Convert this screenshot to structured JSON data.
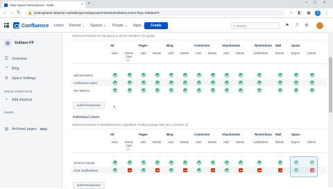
{
  "browser": {
    "tab_title": "View Space Permissions - Soliti...",
    "url": "jessicajosele.atlassian.net/wiki/spaces/spacepermissions/editview.action?key=SolitareFF"
  },
  "header": {
    "brand": "Confluence",
    "nav": [
      "Home",
      "Recent ⌄",
      "Spaces ⌄",
      "People ⌄",
      "Apps ⌄"
    ],
    "create_label": "Create",
    "search_placeholder": "Search"
  },
  "sidebar": {
    "space_name": "Solitare FF",
    "items": [
      "Overview",
      "Blog",
      "Space Settings"
    ],
    "shortcuts_heading": "SPACE SHORTCUTS",
    "add_shortcut": "Add shortcut",
    "pages_heading": "PAGES",
    "archived_pages": "Archived pages",
    "beta": "BETA"
  },
  "groups_section": {
    "description": "Grant permissions for this space to all the members of a group.",
    "row_labels": [
      "administrators",
      "confluence-users",
      "site-admins"
    ],
    "edit_button": "Edit Permissions"
  },
  "individual_section": {
    "title": "Individual Users",
    "description": "Grant permissions to individual users, regardless of which groups they are a member of.",
    "row_labels": [
      "Jessica Ciprate",
      "Chat Notifications"
    ],
    "edit_button": "Edit Permissions"
  },
  "table_groups": [
    "All",
    "Pages",
    "Blog",
    "Comments",
    "Attachments",
    "Restrictions",
    "Mail",
    "Space"
  ],
  "table_columns": [
    "View",
    "Delete Own",
    "Add",
    "Delete",
    "Add",
    "Delete",
    "Add",
    "Delete",
    "Add",
    "Delete",
    "Add/Delete",
    "Delete",
    "Export",
    "Admin"
  ],
  "delete_own_note": "(?)",
  "group_permissions": [
    [
      true,
      true,
      true,
      true,
      true,
      true,
      true,
      true,
      true,
      true,
      true,
      true,
      true,
      true
    ],
    [
      true,
      true,
      true,
      true,
      true,
      true,
      true,
      true,
      true,
      true,
      true,
      true,
      true,
      true
    ],
    [
      true,
      true,
      true,
      true,
      true,
      true,
      true,
      true,
      true,
      true,
      true,
      true,
      true,
      true
    ]
  ],
  "user_permissions": [
    [
      true,
      true,
      true,
      true,
      true,
      true,
      true,
      true,
      true,
      true,
      true,
      true,
      true,
      true
    ],
    [
      true,
      false,
      true,
      false,
      true,
      false,
      true,
      false,
      true,
      false,
      false,
      false,
      true,
      false
    ]
  ],
  "colors": {
    "granted": "#36b37e",
    "denied": "#de350b",
    "brand": "#0052cc"
  },
  "icons": [
    "grid-icon",
    "search-icon",
    "bell-icon",
    "help-icon",
    "settings-icon",
    "overview-icon",
    "blog-icon",
    "settings-icon",
    "plus-icon",
    "archive-icon"
  ]
}
